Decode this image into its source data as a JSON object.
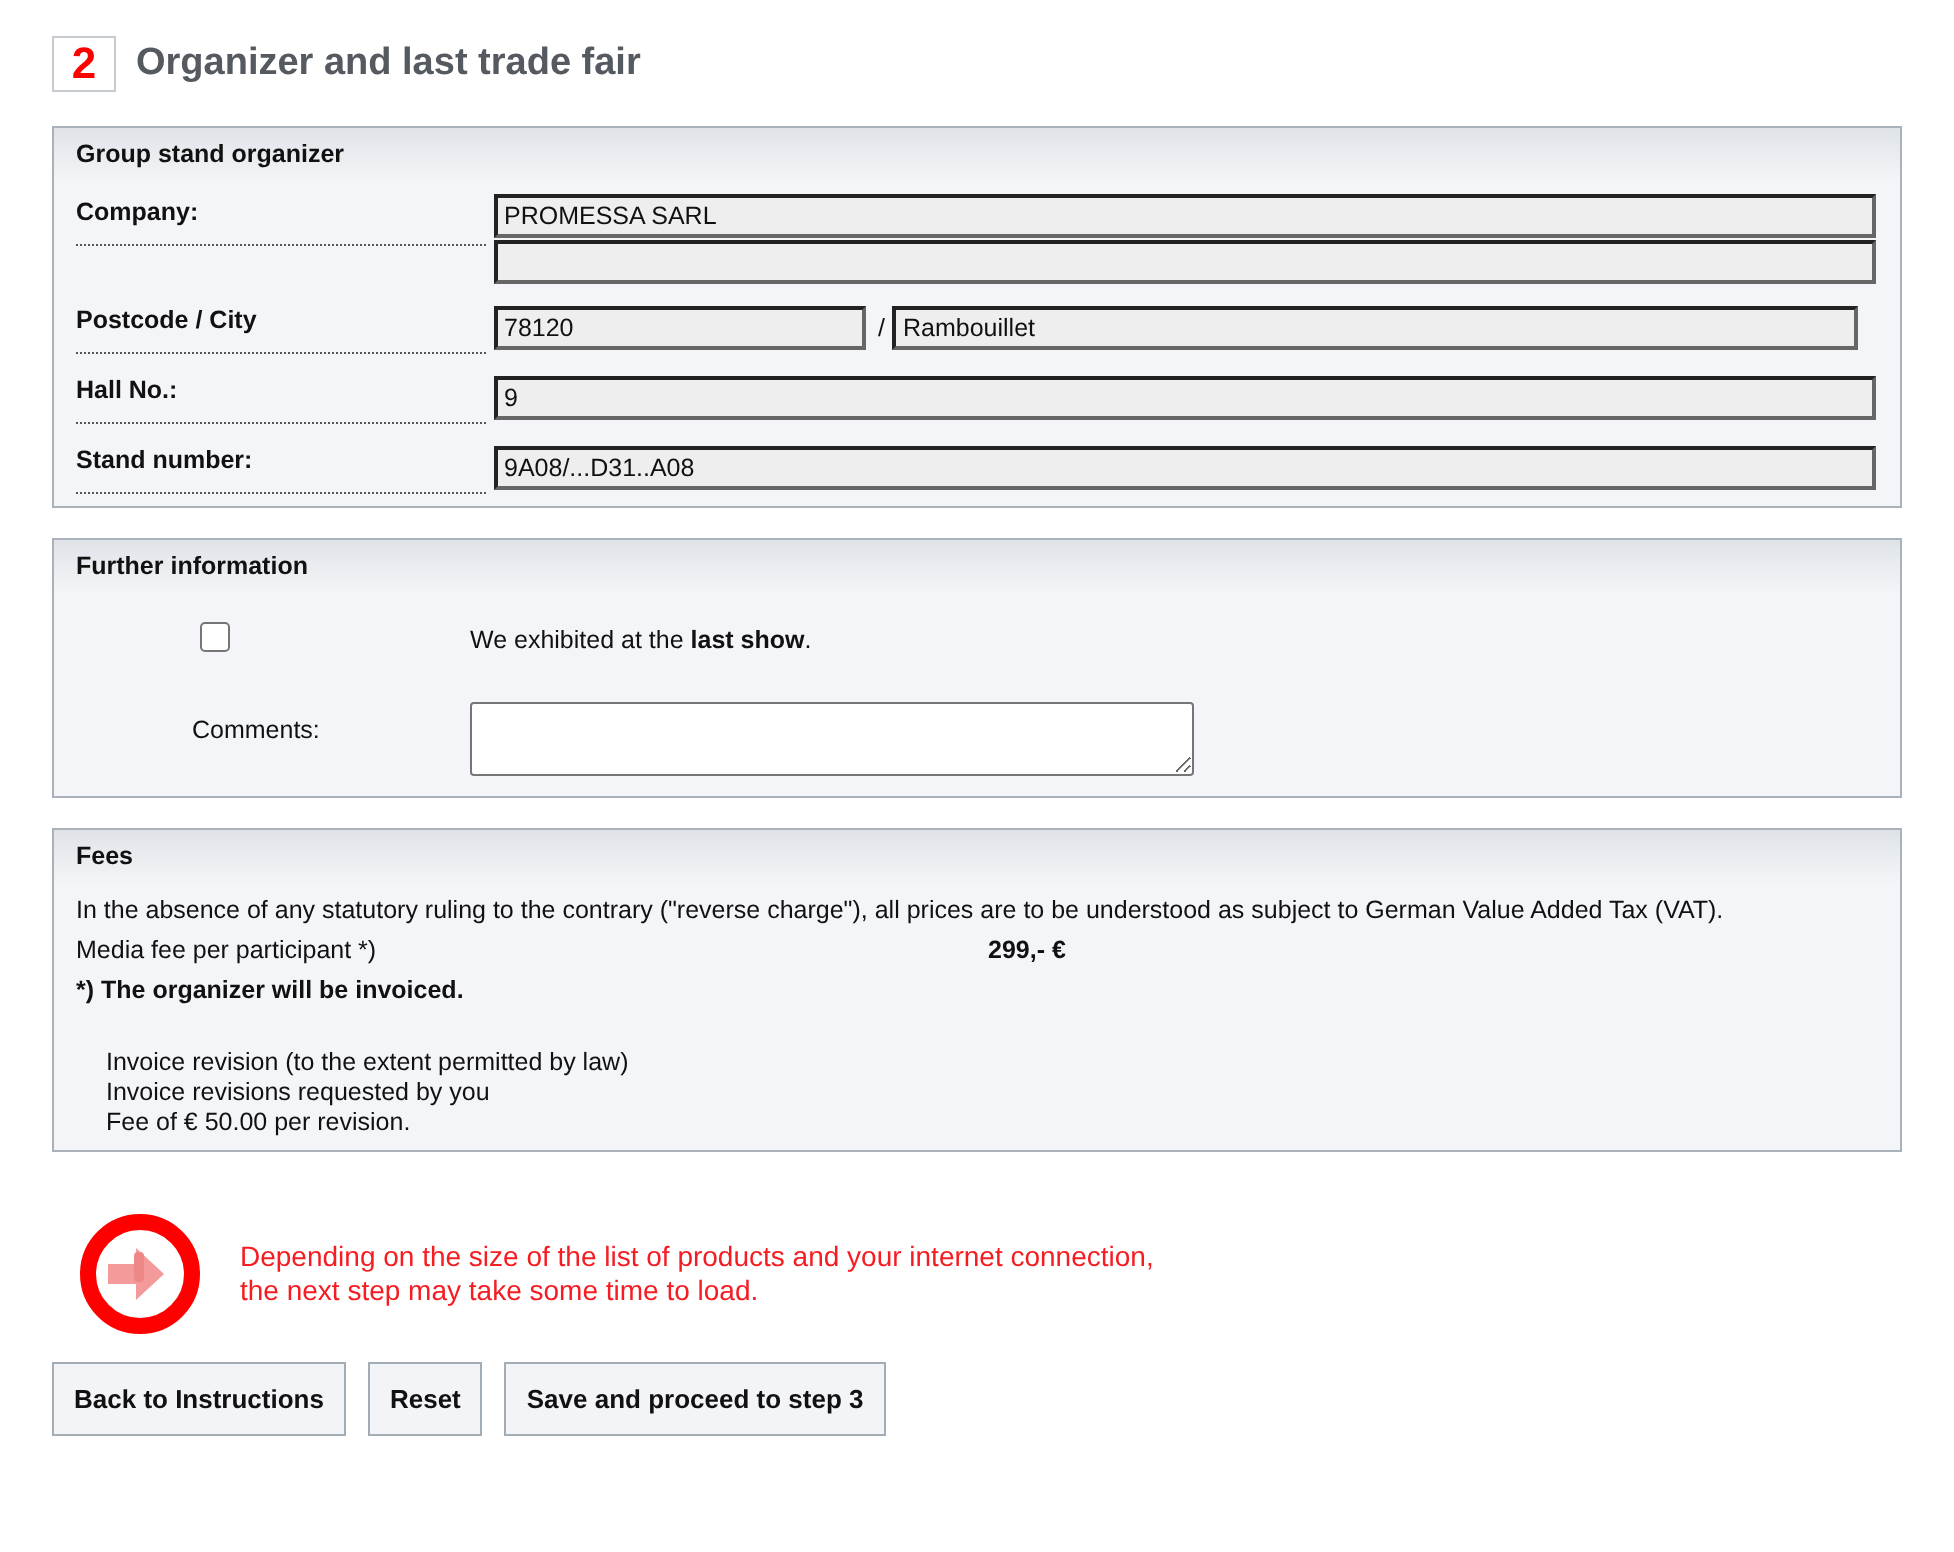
{
  "heading": {
    "number": "2",
    "title": "Organizer and last trade fair"
  },
  "organizer": {
    "title": "Group stand organizer",
    "rows": [
      {
        "label": "Company:",
        "kind": "stack",
        "fields": [
          {
            "value": "PROMESSA SARL"
          },
          {
            "kind": "blank"
          }
        ]
      },
      {
        "label": "Postcode / City",
        "kind": "pair",
        "separator": "/",
        "fields": [
          {
            "value": "78120"
          },
          {
            "value": "Rambouillet"
          }
        ]
      },
      {
        "label": "Hall No.:",
        "kind": "stack",
        "fields": [
          {
            "value": "9"
          }
        ]
      },
      {
        "label": "Stand number:",
        "kind": "stack",
        "fields": [
          {
            "value": "9A08/...D31..A08"
          }
        ]
      }
    ]
  },
  "further_information": {
    "title": "Further information",
    "checkbox": {
      "label": "We exhibited at the **last show**.",
      "checked": false
    },
    "comments": {
      "label": "Comments:"
    }
  },
  "fees": {
    "title": "Fees",
    "vat_note": "In the absence of any statutory ruling to the contrary (\"reverse charge\"), all prices are to be understood as subject to German Value Added Tax (VAT).",
    "fee_label": "Media fee per participant *)",
    "fee_amount": "299,- €",
    "invoice_note": "*) The organizer will be invoiced.",
    "revision_lines": [
      "Invoice revision (to the extent permitted by law)",
      "Invoice revisions requested by you",
      "Fee of € 50.00 per revision."
    ]
  },
  "notice": {
    "lines": [
      "Depending on the size of the list of products and your internet connection,",
      "the next step may take some time to load."
    ]
  },
  "buttons": [
    "Back to Instructions",
    "Reset",
    "Save and proceed to step 3"
  ]
}
